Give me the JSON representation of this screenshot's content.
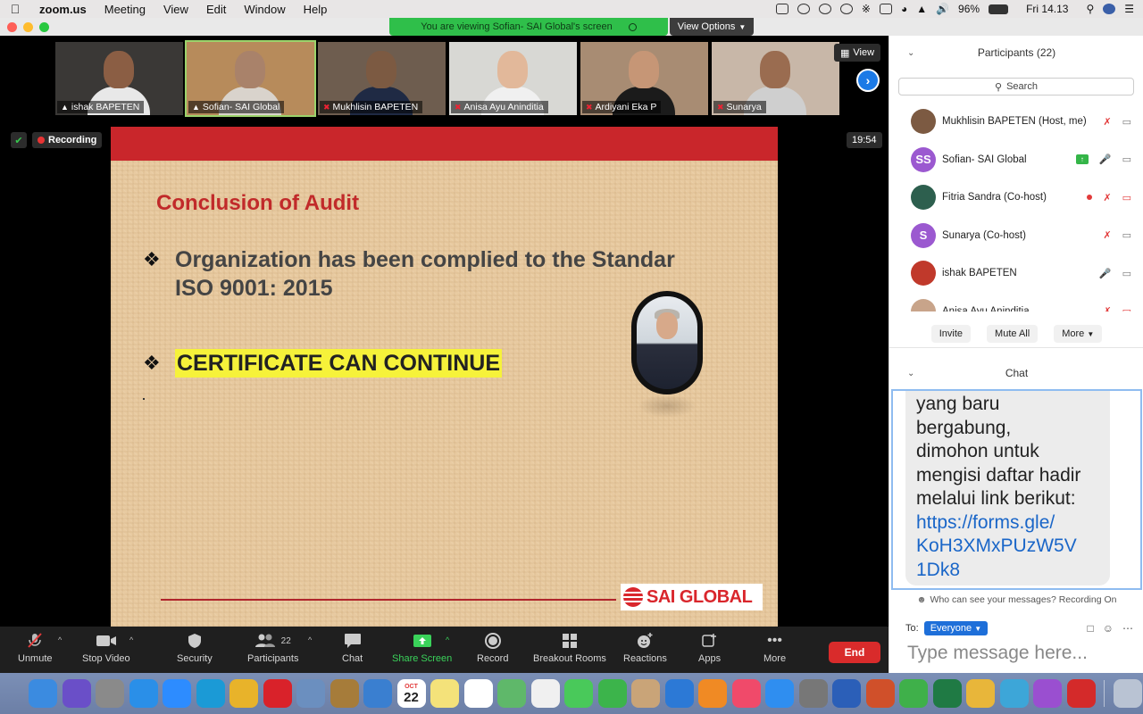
{
  "menubar": {
    "app_name": "zoom.us",
    "menus": [
      "Meeting",
      "View",
      "Edit",
      "Window",
      "Help"
    ],
    "battery": "96%",
    "clock": "Fri 14.13"
  },
  "banner": {
    "viewing_text": "You are viewing Sofian- SAI Global's screen",
    "view_options_label": "View Options"
  },
  "thumbnails": [
    {
      "name": "ishak BAPETEN",
      "bg": "#3a3836",
      "skin": "#8b5e44",
      "shirt": "#e8e8e8",
      "mic": "pinned"
    },
    {
      "name": "Sofian- SAI Global",
      "bg": "#b78b5b",
      "skin": "#a9826a",
      "shirt": "#d9d3cc",
      "mic": "pinned"
    },
    {
      "name": "Mukhlisin BAPETEN",
      "bg": "#6e5d4f",
      "skin": "#7c5a42",
      "shirt": "#1f2a44",
      "mic": "muted"
    },
    {
      "name": "Anisa Ayu Aninditia",
      "bg": "#d8d8d4",
      "skin": "#e2b89a",
      "shirt": "#f0f0f0",
      "mic": "muted"
    },
    {
      "name": "Ardiyani Eka P",
      "bg": "#a88c73",
      "skin": "#c69676",
      "shirt": "#1b1b1b",
      "mic": "muted"
    },
    {
      "name": "Sunarya",
      "bg": "#c8b7a8",
      "skin": "#9a6c50",
      "shirt": "#cfcfcf",
      "mic": "muted"
    }
  ],
  "view_button": "View",
  "recording_label": "Recording",
  "meeting_timer": "19:54",
  "slide": {
    "title": "Conclusion of Audit",
    "bullet1_line1": "Organization has been complied to the Standar",
    "bullet1_line2": "ISO 9001: 2015",
    "bullet2": "CERTIFICATE CAN CONTINUE",
    "logo_text": "SAI GLOBAL"
  },
  "toolbar": {
    "unmute": "Unmute",
    "stop_video": "Stop Video",
    "security": "Security",
    "participants": "Participants",
    "participants_count": "22",
    "chat": "Chat",
    "share_screen": "Share Screen",
    "record": "Record",
    "breakout_rooms": "Breakout Rooms",
    "reactions": "Reactions",
    "apps": "Apps",
    "more": "More",
    "end": "End"
  },
  "participants_panel": {
    "header": "Participants (22)",
    "search_placeholder": "Search",
    "participants": [
      {
        "name": "Mukhlisin BAPETEN (Host, me)",
        "avatar": "",
        "avatar_color": "#7c5a42",
        "mic": "muted",
        "video": "on"
      },
      {
        "name": "Sofian- SAI Global",
        "avatar": "SS",
        "avatar_color": "#9b59d0",
        "mic": "on",
        "video": "on",
        "sharing": true
      },
      {
        "name": "Fitria Sandra (Co-host)",
        "avatar": "",
        "avatar_color": "#2d5f4e",
        "mic": "muted",
        "video": "off",
        "recording": true
      },
      {
        "name": "Sunarya (Co-host)",
        "avatar": "S",
        "avatar_color": "#9b59d0",
        "mic": "muted",
        "video": "on"
      },
      {
        "name": "ishak BAPETEN",
        "avatar": "",
        "avatar_color": "#c0392b",
        "mic": "on",
        "video": "on"
      },
      {
        "name": "Anisa Ayu Aninditia",
        "avatar": "",
        "avatar_color": "#c8a48a",
        "mic": "muted",
        "video": "off"
      }
    ],
    "invite": "Invite",
    "mute_all": "Mute All",
    "more": "More"
  },
  "chat_panel": {
    "header": "Chat",
    "message_lines": [
      "yang baru",
      "bergabung,",
      "dimohon untuk",
      "mengisi daftar hadir",
      "melalui link berikut:"
    ],
    "link_lines": [
      "https://forms.gle/",
      "KoH3XMxPUzW5V",
      "1Dk8"
    ],
    "who_can_see": "Who can see your messages? Recording On",
    "to_label": "To:",
    "recipient": "Everyone",
    "input_placeholder": "Type message here..."
  },
  "dock": {
    "calendar_month": "OCT",
    "calendar_day": "22",
    "apps": [
      {
        "name": "finder-icon",
        "color": "#3b8be0"
      },
      {
        "name": "siri-icon",
        "color": "#6a4fc8"
      },
      {
        "name": "launchpad-icon",
        "color": "#8a8a8a"
      },
      {
        "name": "safari-icon",
        "color": "#2a8fe8"
      },
      {
        "name": "zoom-icon",
        "color": "#2d8cff"
      },
      {
        "name": "edge-icon",
        "color": "#1b9ad6"
      },
      {
        "name": "chrome-icon",
        "color": "#e8b32a"
      },
      {
        "name": "opera-icon",
        "color": "#d9222a"
      },
      {
        "name": "preview-icon",
        "color": "#6b8fbf"
      },
      {
        "name": "notebook-icon",
        "color": "#a67c3a"
      },
      {
        "name": "mail-icon",
        "color": "#3a7fd0"
      },
      {
        "name": "calendar-icon",
        "color": "#ffffff"
      },
      {
        "name": "notes-icon",
        "color": "#f4e27a"
      },
      {
        "name": "reminders-icon",
        "color": "#ffffff"
      },
      {
        "name": "maps-icon",
        "color": "#5fb86a"
      },
      {
        "name": "photos-icon",
        "color": "#f0f0f0"
      },
      {
        "name": "messages-icon",
        "color": "#49c95a"
      },
      {
        "name": "facetime-icon",
        "color": "#3cb44b"
      },
      {
        "name": "contacts-icon",
        "color": "#c9a478"
      },
      {
        "name": "keynote-icon",
        "color": "#2c79d6"
      },
      {
        "name": "books-icon",
        "color": "#f08a24"
      },
      {
        "name": "music-icon",
        "color": "#f04a6a"
      },
      {
        "name": "app-store-icon",
        "color": "#2f8ef0"
      },
      {
        "name": "system-preferences-icon",
        "color": "#777777"
      },
      {
        "name": "word-icon",
        "color": "#2b5fb8"
      },
      {
        "name": "powerpoint-icon",
        "color": "#d0502a"
      },
      {
        "name": "numbers-icon",
        "color": "#3fb04a"
      },
      {
        "name": "excel-icon",
        "color": "#1f7a44"
      },
      {
        "name": "onenote-icon",
        "color": "#e8b63a"
      },
      {
        "name": "sync-icon",
        "color": "#3da6d8"
      },
      {
        "name": "podcasts-icon",
        "color": "#9a4fd0"
      },
      {
        "name": "acrobat-icon",
        "color": "#d42a2a"
      }
    ]
  }
}
